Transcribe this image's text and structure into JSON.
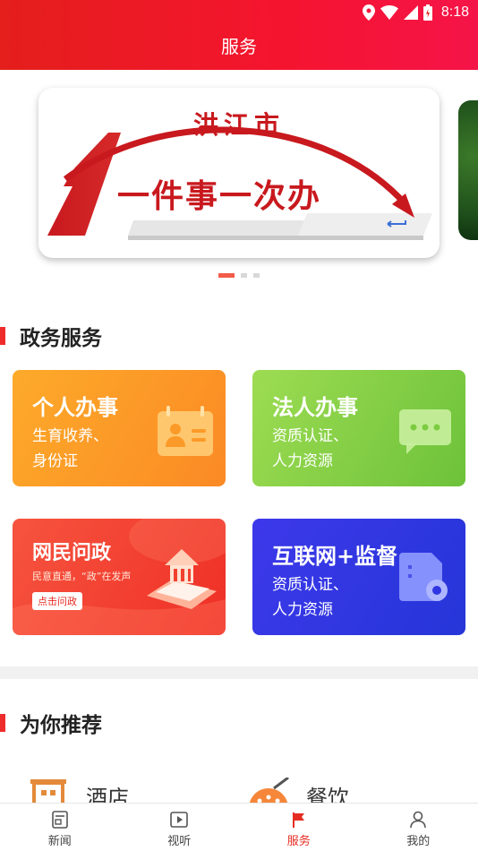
{
  "status_bar": {
    "time": "8:18"
  },
  "header": {
    "title": "服务"
  },
  "banner": {
    "city": "洪江市",
    "number": "1",
    "slogan": "一件事一次办",
    "dots_count": 3,
    "active_dot": 0
  },
  "gov_section": {
    "title": "政务服务"
  },
  "cards": {
    "personal": {
      "title": "个人办事",
      "line1": "生育收养、",
      "line2": "身份证"
    },
    "legal": {
      "title": "法人办事",
      "line1": "资质认证、",
      "line2": "人力资源"
    },
    "netizen": {
      "title": "网民问政",
      "subtitle": "民意直通，“政”在发声",
      "button": "点击问政"
    },
    "internet": {
      "title": "互联网+监督",
      "line1": "资质认证、",
      "line2": "人力资源"
    }
  },
  "recommend_section": {
    "title": "为你推荐"
  },
  "recommend_items": [
    {
      "label": "酒店",
      "icon": "hotel-icon"
    },
    {
      "label": "餐饮",
      "icon": "food-icon"
    }
  ],
  "tabbar": [
    {
      "label": "新闻",
      "icon": "news-icon"
    },
    {
      "label": "视听",
      "icon": "video-icon"
    },
    {
      "label": "服务",
      "icon": "flag-icon",
      "active": true
    },
    {
      "label": "我的",
      "icon": "profile-icon"
    }
  ],
  "colors": {
    "brand_red": "#e52c22",
    "personal": "#fb9a28",
    "legal": "#85d048",
    "netizen": "#f2412f",
    "internet": "#3036e2"
  }
}
